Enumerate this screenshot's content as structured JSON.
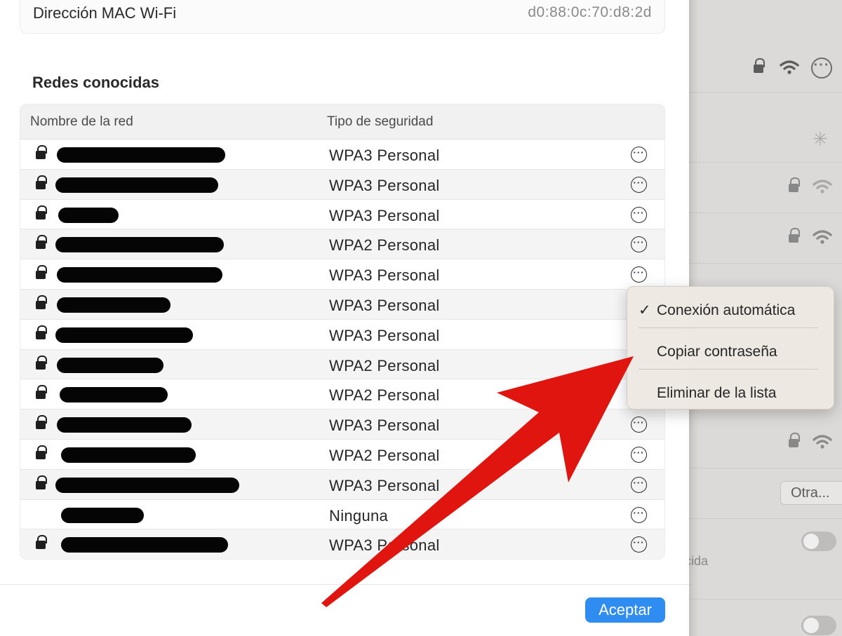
{
  "mac": {
    "label": "Dirección MAC Wi-Fi",
    "value": "d0:88:0c:70:d8:2d"
  },
  "known_networks": {
    "title": "Redes conocidas",
    "headers": {
      "name": "Nombre de la red",
      "security": "Tipo de seguridad"
    },
    "rows": [
      {
        "security": "WPA3 Personal",
        "locked": true
      },
      {
        "security": "WPA3 Personal",
        "locked": true
      },
      {
        "security": "WPA3 Personal",
        "locked": true
      },
      {
        "security": "WPA2 Personal",
        "locked": true
      },
      {
        "security": "WPA3 Personal",
        "locked": true
      },
      {
        "security": "WPA3 Personal",
        "locked": true
      },
      {
        "security": "WPA3 Personal",
        "locked": true
      },
      {
        "security": "WPA2 Personal",
        "locked": true
      },
      {
        "security": "WPA2 Personal",
        "locked": true
      },
      {
        "security": "WPA3 Personal",
        "locked": true
      },
      {
        "security": "WPA2 Personal",
        "locked": true
      },
      {
        "security": "WPA3 Personal",
        "locked": true
      },
      {
        "security": "Ninguna",
        "locked": false
      },
      {
        "security": "WPA3 Personal",
        "locked": true
      }
    ]
  },
  "context_menu": {
    "items": [
      {
        "label": "Conexión automática",
        "checked": true
      },
      {
        "label": "Copiar contraseña",
        "checked": false
      },
      {
        "label": "Eliminar de la lista",
        "checked": false
      }
    ]
  },
  "footer": {
    "accept_label": "Aceptar"
  },
  "background": {
    "other_button": "Otra...",
    "caption": "ocida"
  },
  "colors": {
    "accent": "#2f8cf0",
    "arrow": "#e0150f",
    "redaction": "#050505"
  },
  "icons": [
    "lock-icon",
    "more-icon",
    "wifi-icon",
    "checkmark-icon",
    "spinner-icon"
  ]
}
